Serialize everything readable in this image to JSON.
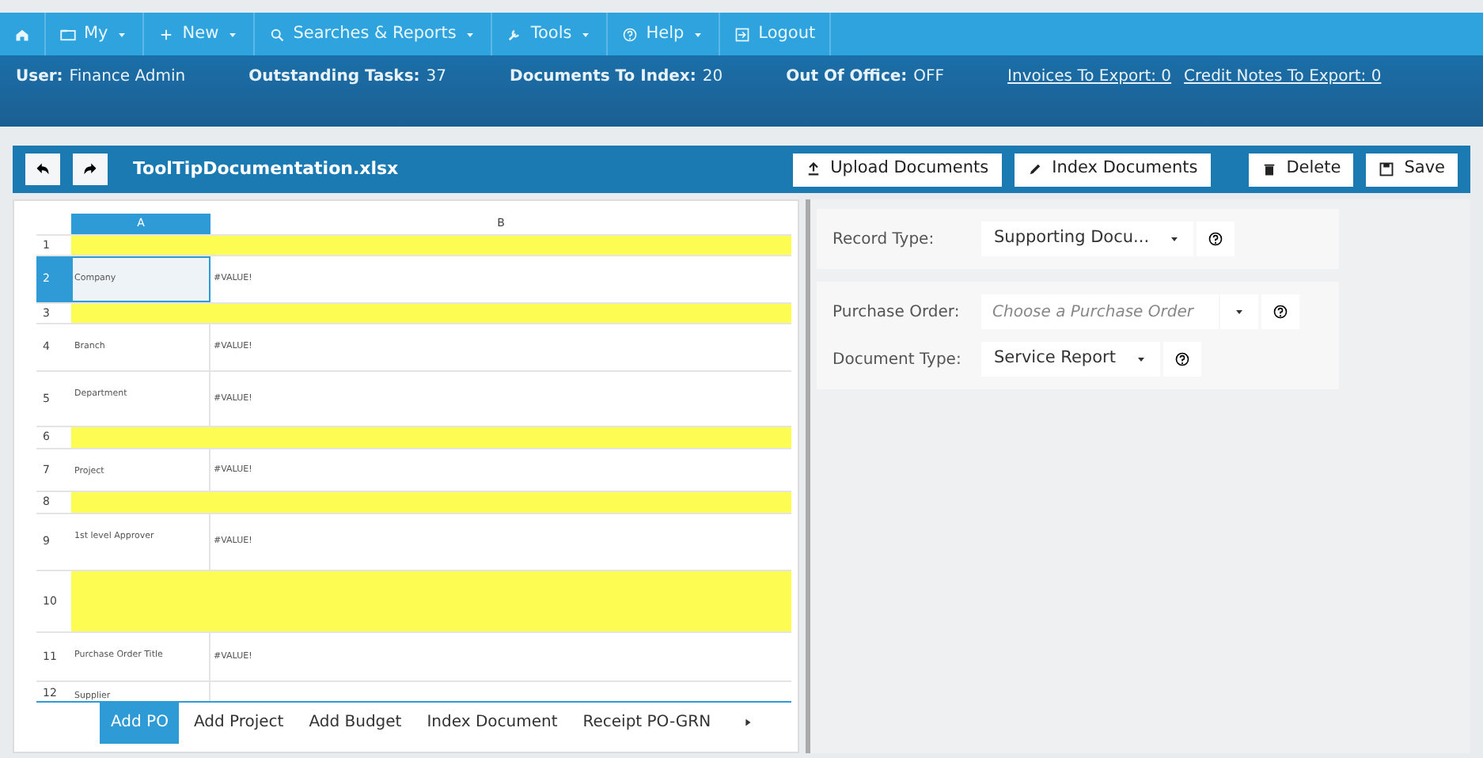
{
  "nav": [
    {
      "kind": "home"
    },
    {
      "kind": "folder",
      "label": "My",
      "has_menu": true
    },
    {
      "kind": "plus",
      "label": "New",
      "has_menu": true
    },
    {
      "kind": "search",
      "label": "Searches & Reports",
      "has_menu": true
    },
    {
      "kind": "wrench",
      "label": "Tools",
      "has_menu": true
    },
    {
      "kind": "help",
      "label": "Help",
      "has_menu": true
    },
    {
      "kind": "logout",
      "label": "Logout",
      "has_menu": false
    }
  ],
  "info": [
    {
      "label": "User:",
      "value": "Finance Admin"
    },
    {
      "label": "Outstanding Tasks:",
      "value": "37"
    },
    {
      "label": "Documents To Index:",
      "value": "20"
    },
    {
      "label": "Out Of Office:",
      "value": "OFF"
    }
  ],
  "info_links": [
    "Invoices To Export: 0",
    "Credit Notes To Export: 0"
  ],
  "document": {
    "title": "ToolTipDocumentation.xlsx"
  },
  "actions": [
    {
      "kind": "upload",
      "label": "Upload Documents"
    },
    {
      "kind": "pencil",
      "label": "Index Documents"
    },
    {
      "kind": "trash",
      "label": "Delete"
    },
    {
      "kind": "save",
      "label": "Save"
    }
  ],
  "sheet": {
    "columns": [
      {
        "label": "A",
        "selected": true
      },
      {
        "label": "B",
        "selected": false
      }
    ],
    "rows": [
      {
        "number": "1",
        "cells": [],
        "highlighted": true,
        "selected": false
      },
      {
        "number": "2",
        "cells": [
          "Company",
          "#VALUE!"
        ],
        "highlighted": false,
        "selected": true
      },
      {
        "number": "3",
        "cells": [],
        "highlighted": true,
        "selected": false
      },
      {
        "number": "4",
        "cells": [
          "Branch",
          "#VALUE!"
        ],
        "highlighted": false,
        "selected": false
      },
      {
        "number": "5",
        "cells": [
          "Department",
          "#VALUE!"
        ],
        "highlighted": false,
        "selected": false
      },
      {
        "number": "6",
        "cells": [],
        "highlighted": true,
        "selected": false
      },
      {
        "number": "7",
        "cells": [
          "Project",
          "#VALUE!"
        ],
        "highlighted": false,
        "selected": false
      },
      {
        "number": "8",
        "cells": [],
        "highlighted": true,
        "selected": false
      },
      {
        "number": "9",
        "cells": [
          "1st level Approver",
          "#VALUE!"
        ],
        "highlighted": false,
        "selected": false
      },
      {
        "number": "10",
        "cells": [],
        "highlighted": true,
        "selected": false
      },
      {
        "number": "11",
        "cells": [
          "Purchase Order Title",
          "#VALUE!"
        ],
        "highlighted": false,
        "selected": false
      },
      {
        "number": "12",
        "cells": [
          "Supplier"
        ],
        "highlighted": false,
        "selected": false
      }
    ],
    "tabs": [
      {
        "label": "Add PO",
        "selected": true
      },
      {
        "label": "Add Project",
        "selected": false
      },
      {
        "label": "Add Budget",
        "selected": false
      },
      {
        "label": "Index Document",
        "selected": false
      },
      {
        "label": "Receipt PO-GRN",
        "selected": false
      }
    ]
  },
  "form_groups": [
    [
      {
        "label": "Record Type:",
        "value": "Supporting Docu..."
      }
    ],
    [
      {
        "label": "Purchase Order:",
        "placeholder": "Choose a Purchase Order"
      },
      {
        "label": "Document Type:",
        "value": "Service Report"
      }
    ]
  ]
}
